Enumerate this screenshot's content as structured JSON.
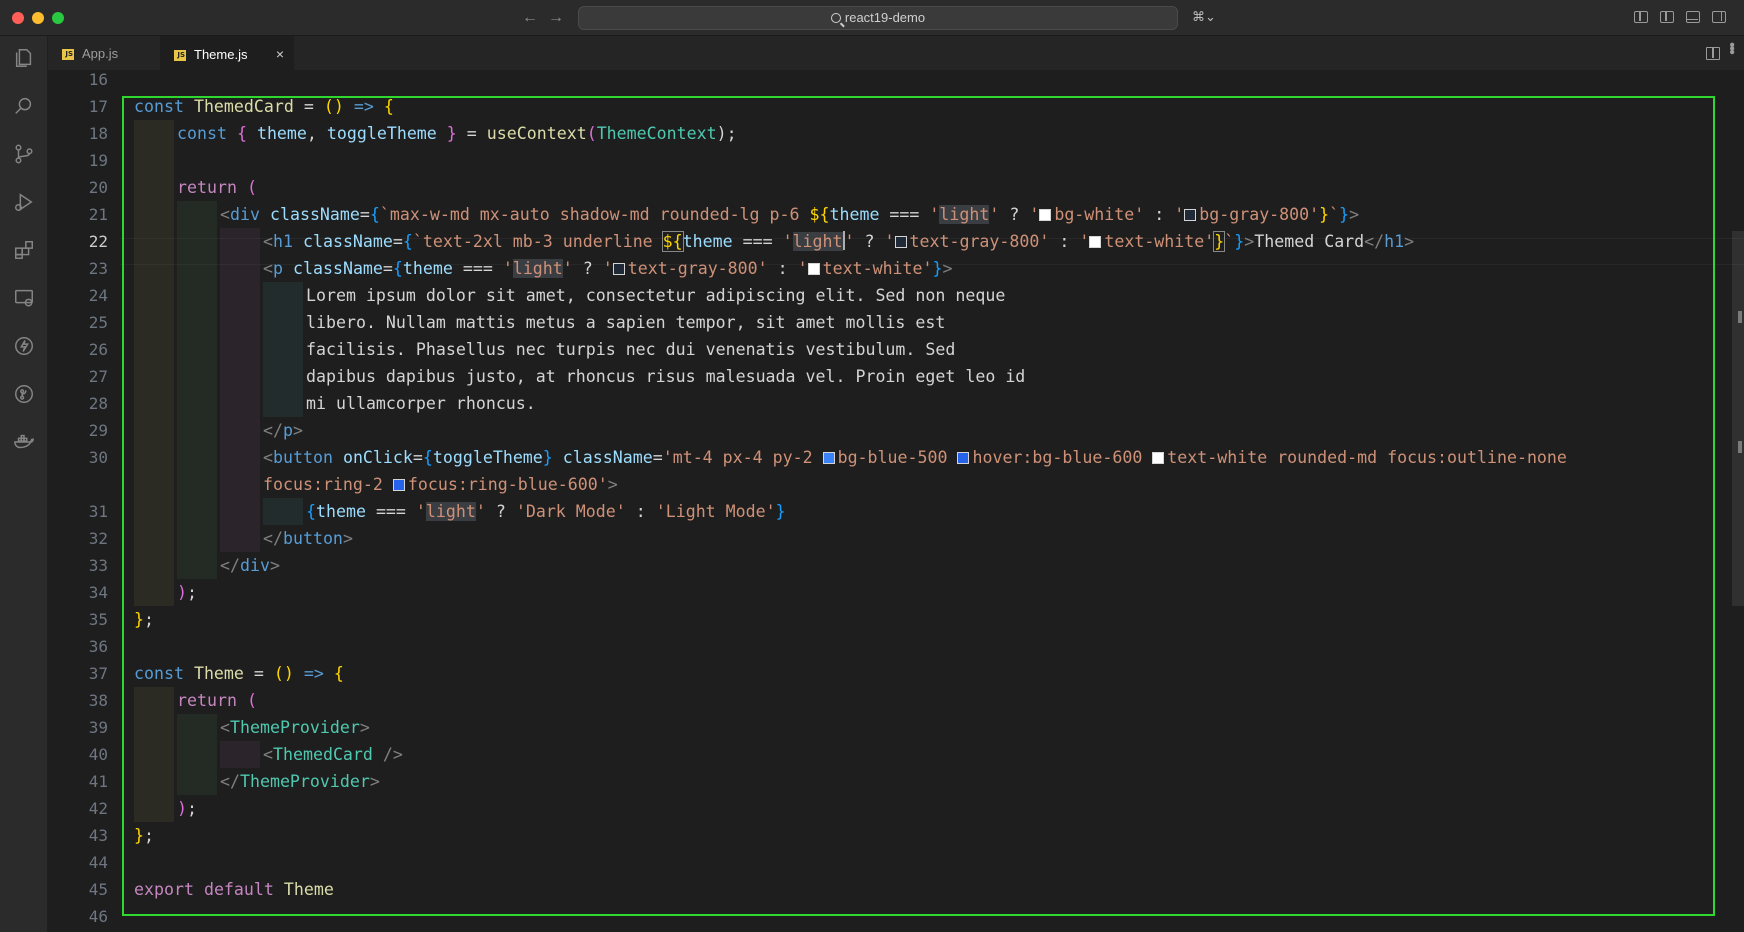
{
  "window": {
    "search_text": "react19-demo",
    "nav_back": "←",
    "nav_forward": "→",
    "copilot_label": "⌘",
    "copilot_chevron": "⌄"
  },
  "activity_bar": {
    "items": [
      "explorer-icon",
      "search-icon",
      "source-control-icon",
      "run-debug-icon",
      "extensions-icon",
      "remote-explorer-icon",
      "lightning-icon",
      "git-graph-icon",
      "docker-icon"
    ]
  },
  "tabs": [
    {
      "label": "App.js",
      "icon": "JS",
      "active": false
    },
    {
      "label": "Theme.js",
      "icon": "JS",
      "active": true,
      "close": "×"
    }
  ],
  "editor": {
    "current_line": "22",
    "line_numbers": [
      "16",
      "17",
      "18",
      "19",
      "20",
      "21",
      "22",
      "23",
      "24",
      "25",
      "26",
      "27",
      "28",
      "29",
      "30",
      "",
      "31",
      "32",
      "33",
      "34",
      "35",
      "36",
      "37",
      "38",
      "39",
      "40",
      "41",
      "42",
      "43",
      "44",
      "45",
      "46"
    ],
    "code": {
      "l17": [
        "const",
        " ",
        "ThemedCard",
        " = ",
        "()",
        " ",
        "=>",
        " ",
        "{"
      ],
      "l18": [
        "const",
        " ",
        "{",
        " ",
        "theme",
        ", ",
        "toggleTheme",
        " ",
        "}",
        " = ",
        "useContext",
        "(",
        "ThemeContext",
        ");"
      ],
      "l20": [
        "return",
        " ",
        "("
      ],
      "l21": [
        "<",
        "div",
        " ",
        "className",
        "=",
        "{",
        "`max-w-md mx-auto shadow-md rounded-lg p-6 ",
        "${",
        "theme",
        " === ",
        "'",
        "light",
        "'",
        " ? ",
        "'",
        "bg-white",
        "'",
        " : ",
        "'",
        "bg-gray-800",
        "'",
        "}",
        "`",
        "}",
        ">"
      ],
      "l22": [
        "<",
        "h1",
        " ",
        "className",
        "=",
        "{",
        "`text-2xl mb-3 underline ",
        "${",
        "theme",
        " === ",
        "'",
        "light",
        "'",
        " ? ",
        "'",
        "text-gray-800",
        "'",
        " : ",
        "'",
        "text-white",
        "'",
        "}",
        "`",
        "}",
        ">",
        "Themed Card",
        "</",
        "h1",
        ">"
      ],
      "l23": [
        "<",
        "p",
        " ",
        "className",
        "=",
        "{",
        "theme",
        " === ",
        "'",
        "light",
        "'",
        " ? ",
        "'",
        "text-gray-800",
        "'",
        " : ",
        "'",
        "text-white",
        "'",
        "}",
        ">"
      ],
      "l24": "Lorem ipsum dolor sit amet, consectetur adipiscing elit. Sed non neque",
      "l25": "libero. Nullam mattis metus a sapien tempor, sit amet mollis est",
      "l26": "facilisis. Phasellus nec turpis nec dui venenatis vestibulum. Sed",
      "l27": "dapibus dapibus justo, at rhoncus risus malesuada vel. Proin eget leo id",
      "l28": "mi ullamcorper rhoncus.",
      "l29": [
        "</",
        "p",
        ">"
      ],
      "l30": [
        "<",
        "button",
        " ",
        "onClick",
        "=",
        "{",
        "toggleTheme",
        "}",
        " ",
        "className",
        "=",
        "'mt-4 px-4 py-2 ",
        "bg-blue-500 ",
        "hover:bg-blue-600 ",
        "text-white rounded-md focus:outline-none"
      ],
      "l30b": [
        "focus:ring-2 ",
        "focus:ring-blue-600",
        "'",
        ">"
      ],
      "l31": [
        "{",
        "theme",
        " === ",
        "'",
        "light",
        "'",
        " ? ",
        "'Dark Mode'",
        " : ",
        "'Light Mode'",
        "}"
      ],
      "l32": [
        "</",
        "button",
        ">"
      ],
      "l33": [
        "</",
        "div",
        ">"
      ],
      "l34": [
        ")",
        ";"
      ],
      "l35": [
        "}",
        ";"
      ],
      "l37": [
        "const",
        " ",
        "Theme",
        " = ",
        "()",
        " ",
        "=>",
        " ",
        "{"
      ],
      "l38": [
        "return",
        " ",
        "("
      ],
      "l39": [
        "<",
        "ThemeProvider",
        ">"
      ],
      "l40": [
        "<",
        "ThemedCard",
        " ",
        "/>"
      ],
      "l41": [
        "</",
        "ThemeProvider",
        ">"
      ],
      "l42": [
        ")",
        ";"
      ],
      "l43": [
        "}",
        ";"
      ],
      "l45": [
        "export",
        " ",
        "default",
        " ",
        "Theme"
      ]
    }
  },
  "colors": {
    "highlight_frame": "#2fd82f",
    "editor_bg": "#1e1e1e",
    "keyword": "#569cd6",
    "string": "#ce9178",
    "function": "#dcdcaa",
    "variable": "#9cdcfe",
    "type": "#4ec9b0"
  }
}
